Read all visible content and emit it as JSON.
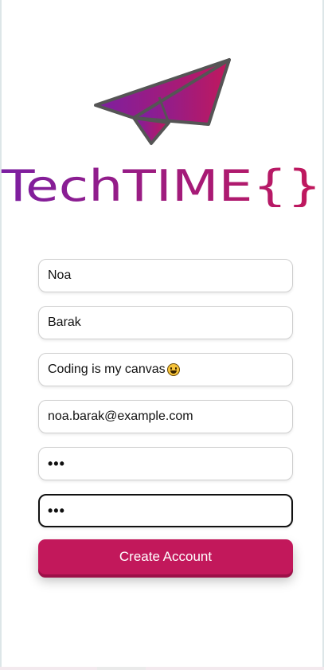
{
  "brand": {
    "name": "TechTIME{}",
    "colors": {
      "gradient_start": "#7b1fa2",
      "gradient_end": "#c2185b",
      "outline": "#555555"
    }
  },
  "form": {
    "first_name": {
      "value": "Noa"
    },
    "last_name": {
      "value": "Barak"
    },
    "bio": {
      "value": "Coding is my canvas",
      "emoji": "smiling-face-icon"
    },
    "email": {
      "value": "noa.barak@example.com"
    },
    "password": {
      "value": "•••"
    },
    "confirm_password": {
      "value": "•••"
    }
  },
  "submit": {
    "label": "Create Account",
    "color": "#c2185b"
  }
}
